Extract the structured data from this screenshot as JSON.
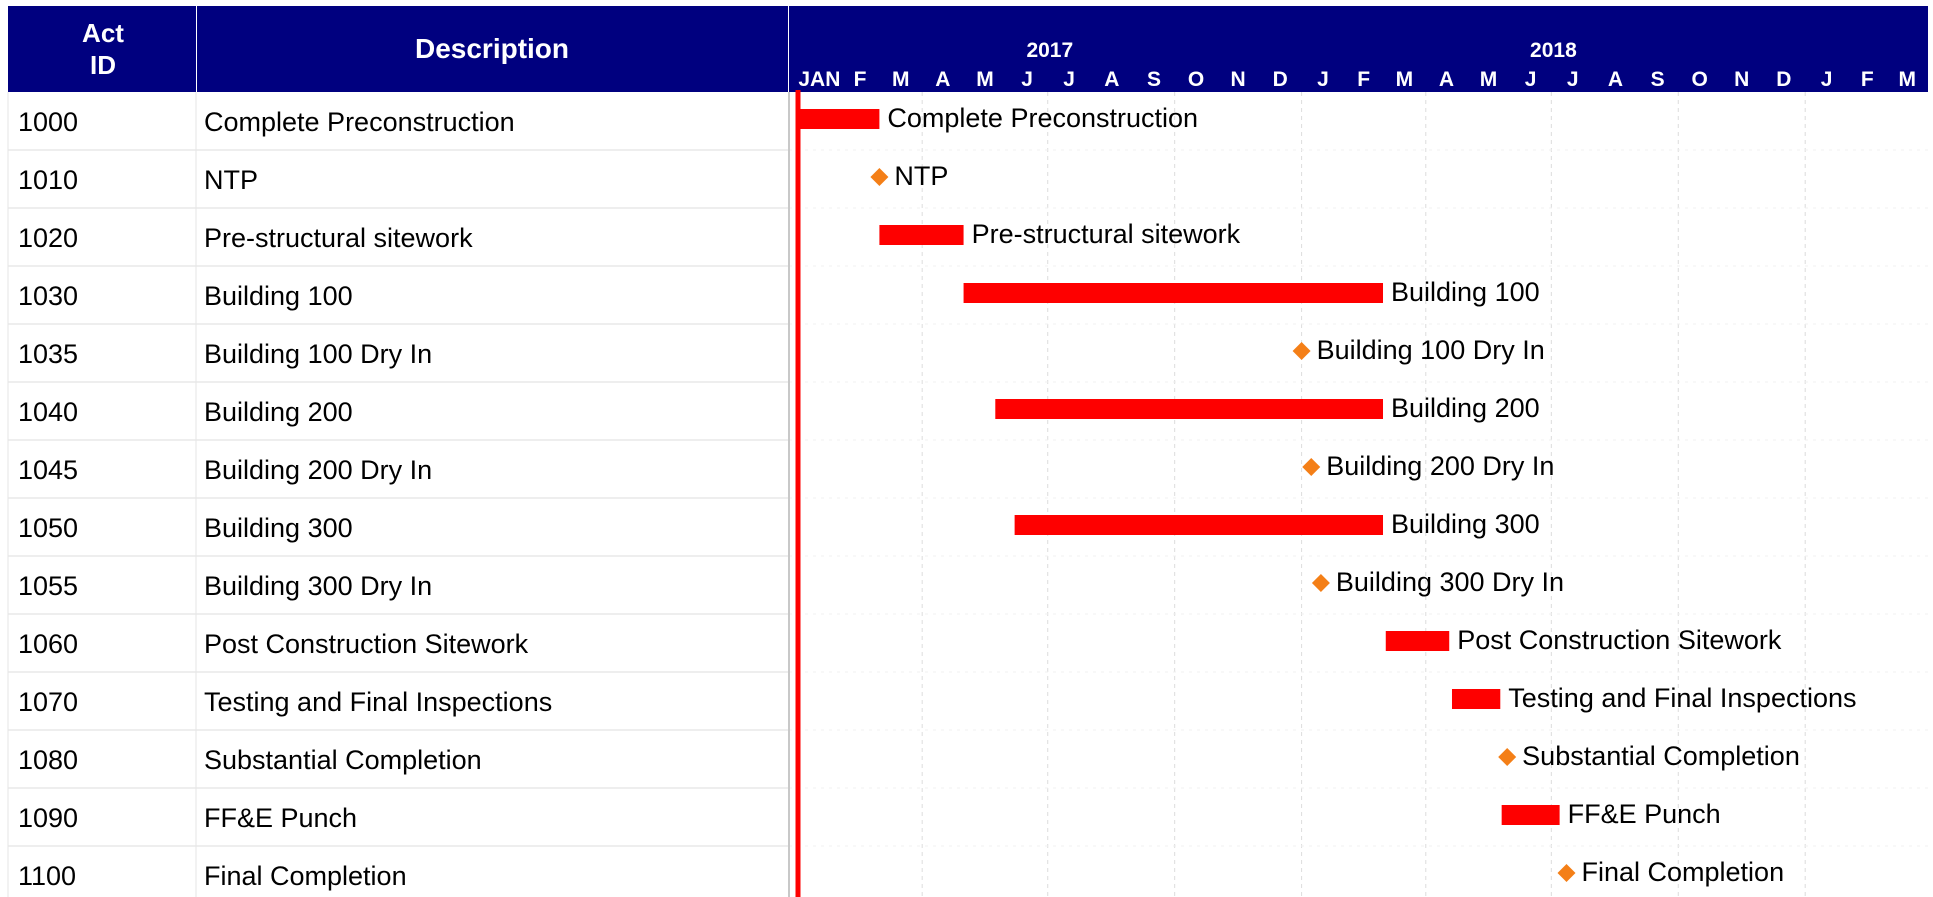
{
  "table": {
    "headers": {
      "act_id_line1": "Act",
      "act_id_line2": "ID",
      "description": "Description"
    }
  },
  "timeline": {
    "years": [
      "2017",
      "2018"
    ],
    "months": [
      "JAN",
      "F",
      "M",
      "A",
      "M",
      "J",
      "J",
      "A",
      "S",
      "O",
      "N",
      "D",
      "J",
      "F",
      "M",
      "A",
      "M",
      "J",
      "J",
      "A",
      "S",
      "O",
      "N",
      "D",
      "J",
      "F",
      "M"
    ]
  },
  "chart_data": {
    "type": "gantt",
    "x_start": "2017-01-01",
    "x_end": "2019-03-31",
    "data_date": "2017-01-01",
    "activities": [
      {
        "id": "1000",
        "description": "Complete Preconstruction",
        "kind": "task",
        "start": "2017-01-01",
        "finish": "2017-03-01"
      },
      {
        "id": "1010",
        "description": "NTP",
        "kind": "milestone",
        "date": "2017-03-01"
      },
      {
        "id": "1020",
        "description": "Pre-structural sitework",
        "kind": "task",
        "start": "2017-03-01",
        "finish": "2017-05-01"
      },
      {
        "id": "1030",
        "description": "Building 100",
        "kind": "task",
        "start": "2017-05-01",
        "finish": "2018-03-01"
      },
      {
        "id": "1035",
        "description": "Building 100 Dry In",
        "kind": "milestone",
        "date": "2018-01-01"
      },
      {
        "id": "1040",
        "description": "Building 200",
        "kind": "task",
        "start": "2017-05-24",
        "finish": "2018-03-01"
      },
      {
        "id": "1045",
        "description": "Building 200 Dry In",
        "kind": "milestone",
        "date": "2018-01-08"
      },
      {
        "id": "1050",
        "description": "Building 300",
        "kind": "task",
        "start": "2017-06-07",
        "finish": "2018-03-01"
      },
      {
        "id": "1055",
        "description": "Building 300 Dry In",
        "kind": "milestone",
        "date": "2018-01-15"
      },
      {
        "id": "1060",
        "description": "Post Construction Sitework",
        "kind": "task",
        "start": "2018-03-03",
        "finish": "2018-04-18"
      },
      {
        "id": "1070",
        "description": "Testing and Final Inspections",
        "kind": "task",
        "start": "2018-04-20",
        "finish": "2018-05-25"
      },
      {
        "id": "1080",
        "description": "Substantial Completion",
        "kind": "milestone",
        "date": "2018-05-30"
      },
      {
        "id": "1090",
        "description": "FF&E Punch",
        "kind": "task",
        "start": "2018-05-26",
        "finish": "2018-07-07"
      },
      {
        "id": "1100",
        "description": "Final Completion",
        "kind": "milestone",
        "date": "2018-07-12"
      }
    ],
    "colors": {
      "header": "#00007f",
      "bar": "#fe0000",
      "milestone": "#f47f17",
      "data_date_line": "#fe0000",
      "grid": "#dcdcdc"
    }
  }
}
